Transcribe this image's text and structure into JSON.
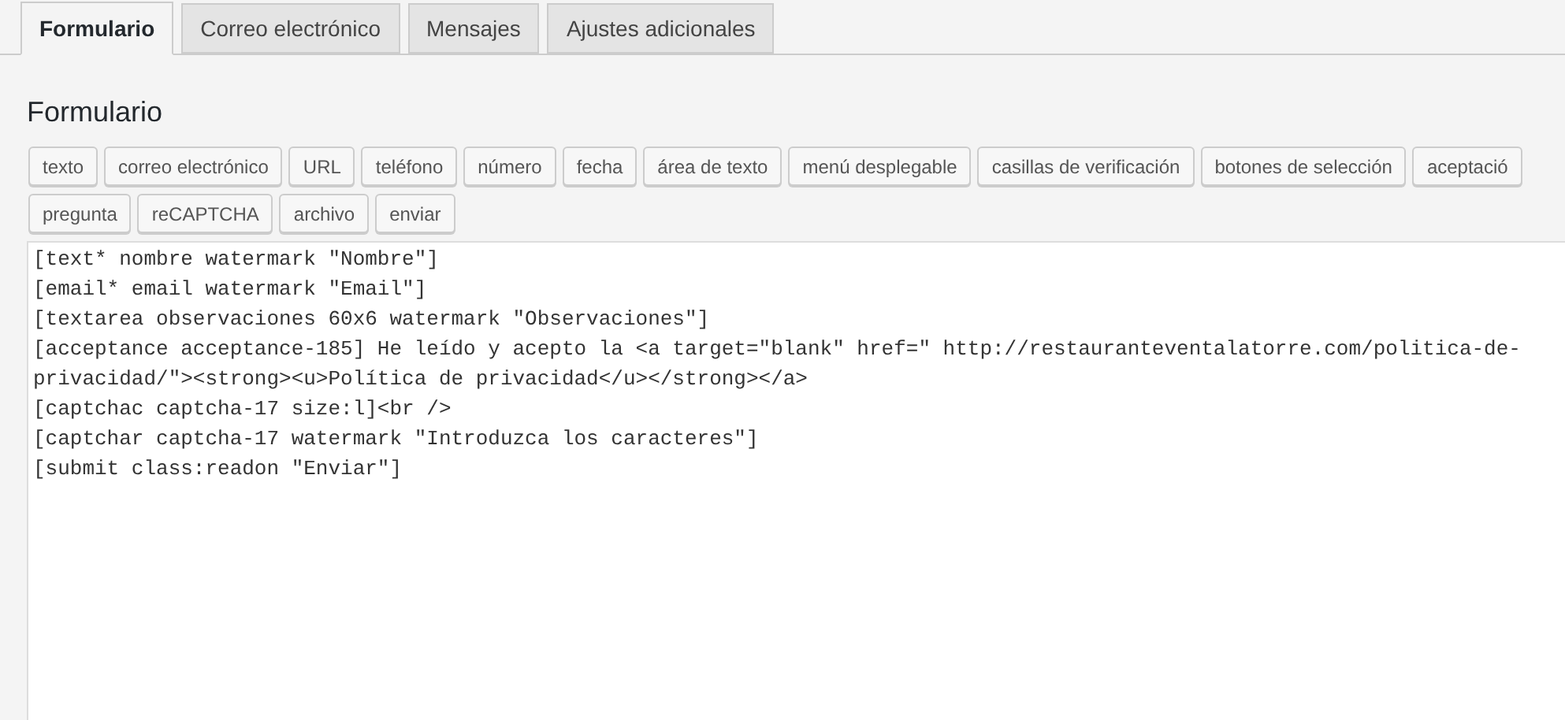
{
  "tabs": [
    {
      "label": "Formulario",
      "selected": true
    },
    {
      "label": "Correo electrónico",
      "selected": false
    },
    {
      "label": "Mensajes",
      "selected": false
    },
    {
      "label": "Ajustes adicionales",
      "selected": false
    }
  ],
  "heading": "Formulario",
  "tag_buttons": [
    [
      "texto",
      "correo electrónico",
      "URL",
      "teléfono",
      "número",
      "fecha",
      "área de texto",
      "menú desplegable",
      "casillas de verificación",
      "botones de selección",
      "aceptació"
    ],
    [
      "pregunta",
      "reCAPTCHA",
      "archivo",
      "enviar"
    ]
  ],
  "editor": {
    "lines": [
      "[text* nombre watermark \"Nombre\"]",
      "[email* email watermark \"Email\"]",
      "[textarea observaciones 60x6 watermark \"Observaciones\"]",
      "[acceptance acceptance-185] He leído y acepto la <a target=\"blank\" href=\" http://restauranteventalatorre.com/politica-de-privacidad/\"><strong><u>Política de privacidad</u></strong></a>",
      "[captchac captcha-17 size:l]<br />",
      "[captchar captcha-17 watermark \"Introduzca los caracteres\"]",
      "[submit class:readon \"Enviar\"]"
    ]
  }
}
